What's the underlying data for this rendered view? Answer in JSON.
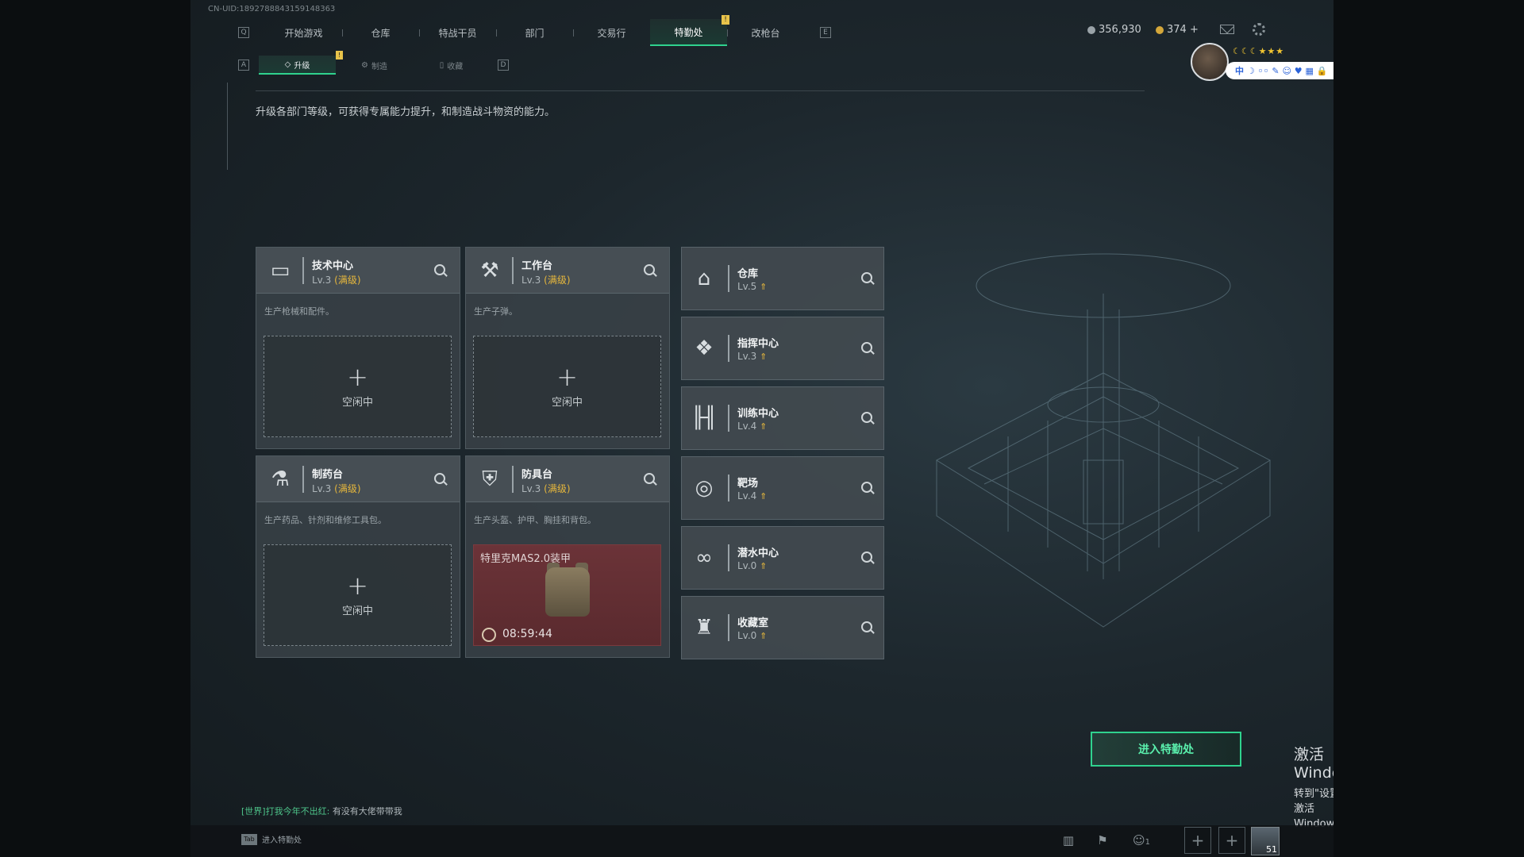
{
  "uid": "CN-UID:1892788843159148363",
  "topnav": {
    "left_key": "Q",
    "right_key": "E",
    "items": [
      {
        "label": "开始游戏"
      },
      {
        "label": "仓库"
      },
      {
        "label": "特战干员"
      },
      {
        "label": "部门"
      },
      {
        "label": "交易行"
      },
      {
        "label": "特勤处"
      },
      {
        "label": "改枪台"
      }
    ],
    "active_index": 5,
    "badge": "!"
  },
  "currency": {
    "silver": "356,930",
    "gold": "374 +"
  },
  "profile": {
    "stars": "☾☾☾★★★",
    "badges": "中 ☽ ◦◦ ✎ ☺ ♥ ▦ 🔒"
  },
  "subnav": {
    "left_key": "A",
    "right_key": "D",
    "items": [
      {
        "label": "升级"
      },
      {
        "label": "制造"
      },
      {
        "label": "收藏"
      }
    ],
    "badge": "!"
  },
  "description": "升级各部门等级，可获得专属能力提升，和制造战斗物资的能力。",
  "production_cards": [
    {
      "name": "技术中心",
      "lv": "Lv.3",
      "max": "(满级)",
      "desc": "生产枪械和配件。",
      "slot": "空闲中",
      "icon": "monitor-icon"
    },
    {
      "name": "工作台",
      "lv": "Lv.3",
      "max": "(满级)",
      "desc": "生产子弹。",
      "slot": "空闲中",
      "icon": "tools-icon"
    },
    {
      "name": "制药台",
      "lv": "Lv.3",
      "max": "(满级)",
      "desc": "生产药品、针剂和维修工具包。",
      "slot": "空闲中",
      "icon": "microscope-icon"
    },
    {
      "name": "防具台",
      "lv": "Lv.3",
      "max": "(满级)",
      "desc": "生产头盔、护甲、胸挂和背包。",
      "busy_item": "特里克MAS2.0装甲",
      "timer": "08:59:44",
      "icon": "armor-icon"
    }
  ],
  "facilities": [
    {
      "name": "仓库",
      "lv": "Lv.5",
      "icon": "warehouse-icon"
    },
    {
      "name": "指挥中心",
      "lv": "Lv.3",
      "icon": "command-icon"
    },
    {
      "name": "训练中心",
      "lv": "Lv.4",
      "icon": "dumbbell-icon"
    },
    {
      "name": "靶场",
      "lv": "Lv.4",
      "icon": "target-icon"
    },
    {
      "name": "潜水中心",
      "lv": "Lv.0",
      "icon": "goggles-icon"
    },
    {
      "name": "收藏室",
      "lv": "Lv.0",
      "icon": "trophy-icon"
    }
  ],
  "enter_button": "进入特勤处",
  "chat": {
    "channel": "[世界]",
    "user": "打我今年不出红:",
    "message": "有没有大佬带带我"
  },
  "bottom": {
    "tab_key": "Tab",
    "tab_label": "进入特勤处",
    "friends_count": "1",
    "level": "51"
  },
  "activation": {
    "line1": "激活 Windows",
    "line2": "转到\"设置\"以激活 Windows。"
  },
  "colors": {
    "accent": "#2fd28e",
    "gold": "#e6b73c",
    "busy": "#6b3338"
  }
}
